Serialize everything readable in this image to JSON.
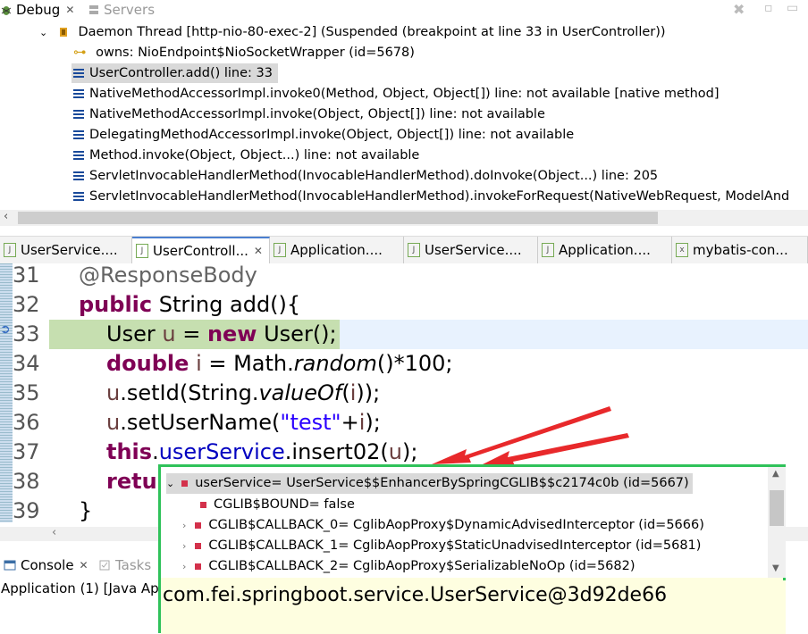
{
  "debug_tabs": [
    {
      "label": "Debug",
      "active": true
    },
    {
      "label": "Servers",
      "active": false
    }
  ],
  "thread": {
    "label": "Daemon Thread [http-nio-80-exec-2] (Suspended (breakpoint at line 33 in UserController))",
    "owns": "owns: NioEndpoint$NioSocketWrapper  (id=5678)",
    "frames": [
      "UserController.add() line: 33",
      "NativeMethodAccessorImpl.invoke0(Method, Object, Object[]) line: not available [native method]",
      "NativeMethodAccessorImpl.invoke(Object, Object[]) line: not available",
      "DelegatingMethodAccessorImpl.invoke(Object, Object[]) line: not available",
      "Method.invoke(Object, Object...) line: not available",
      "ServletInvocableHandlerMethod(InvocableHandlerMethod).doInvoke(Object...) line: 205",
      "ServletInvocableHandlerMethod(InvocableHandlerMethod).invokeForRequest(NativeWebRequest, ModelAnd"
    ]
  },
  "editor_tabs": [
    {
      "label": "UserService....",
      "active": false
    },
    {
      "label": "UserControll...",
      "active": true
    },
    {
      "label": "Application....",
      "active": false
    },
    {
      "label": "UserService....",
      "active": false
    },
    {
      "label": "Application....",
      "active": false
    },
    {
      "label": "mybatis-con...",
      "active": false
    }
  ],
  "code": {
    "line_numbers": [
      "31",
      "32",
      "33",
      "34",
      "35",
      "36",
      "37",
      "38",
      "39"
    ],
    "l31": {
      "ann": "@ResponseBody"
    },
    "l32": {
      "kw": "public",
      "rest": " String add(){"
    },
    "l33": {
      "a": "User ",
      "v": "u",
      "b": " = ",
      "kw": "new",
      "c": " User();"
    },
    "l34": {
      "kw": "double",
      "v": " i",
      "a": " = Math.",
      "it": "random",
      "b": "()*100;"
    },
    "l35": {
      "v": "u",
      "a": ".setId(String.",
      "it": "valueOf",
      "b": "(",
      "v2": "i",
      "c": "));"
    },
    "l36": {
      "v": "u",
      "a": ".setUserName(",
      "str": "\"test\"",
      "b": "+",
      "v2": "i",
      "c": ");"
    },
    "l37": {
      "kw": "this",
      "a": ".",
      "fld": "userService",
      "b": ".insert02(",
      "v": "u",
      "c": ");"
    },
    "l38": {
      "kw": "retu"
    },
    "l39": {
      "a": "}"
    }
  },
  "console_tabs": [
    {
      "label": "Console",
      "active": true
    },
    {
      "label": "Tasks",
      "active": false
    }
  ],
  "console_text": "Application (1) [Java App",
  "popup": {
    "root": "userService= UserService$$EnhancerBySpringCGLIB$$c2174c0b  (id=5667)",
    "children": [
      "CGLIB$BOUND= false",
      "CGLIB$CALLBACK_0= CglibAopProxy$DynamicAdvisedInterceptor  (id=5666)",
      "CGLIB$CALLBACK_1= CglibAopProxy$StaticUnadvisedInterceptor  (id=5681)",
      "CGLIB$CALLBACK_2= CglibAopProxy$SerializableNoOp  (id=5682)"
    ],
    "detail": "com.fei.springboot.service.UserService@3d92de66"
  },
  "colors": {
    "keyword": "#7f0055",
    "string": "#2a00ff",
    "field": "#0000c0",
    "popup_border": "#2fc25a",
    "annotation_arrow": "#e8292b"
  }
}
